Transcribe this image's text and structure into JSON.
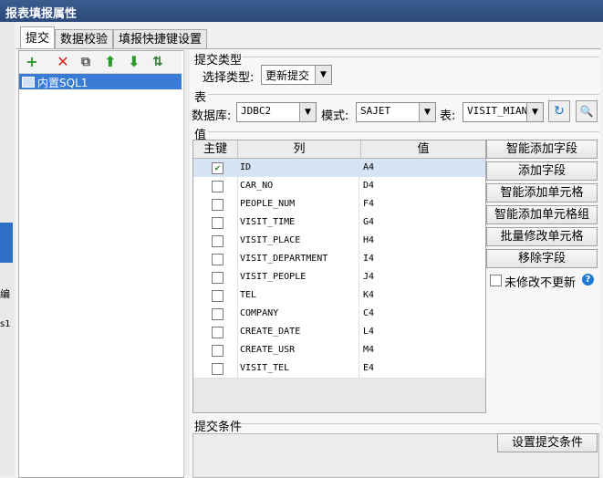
{
  "window": {
    "title": "报表填报属性"
  },
  "background": {
    "text1": "编",
    "text2": "s1"
  },
  "tabs": [
    {
      "label": "提交",
      "active": true
    },
    {
      "label": "数据校验",
      "active": false
    },
    {
      "label": "填报快捷键设置",
      "active": false
    }
  ],
  "toolbar": {
    "add": "+",
    "delete": "✕",
    "copy": "⧉",
    "up": "⬆",
    "down": "⬇",
    "sort": "⇅"
  },
  "list": {
    "items": [
      {
        "label": "内置SQL1",
        "selected": true
      }
    ]
  },
  "submit_type": {
    "group": "提交类型",
    "label": "选择类型:",
    "value": "更新提交"
  },
  "table_section": {
    "group": "表",
    "db_label": "数据库:",
    "db_value": "JDBC2",
    "schema_label": "模式:",
    "schema_value": "SAJET",
    "table_label": "表:",
    "table_value": "VISIT_MIAN"
  },
  "value_section": {
    "group": "值",
    "headers": [
      "主键",
      "列",
      "值"
    ],
    "rows": [
      {
        "key": true,
        "column": "ID",
        "value": "A4"
      },
      {
        "key": false,
        "column": "CAR_NO",
        "value": "D4"
      },
      {
        "key": false,
        "column": "PEOPLE_NUM",
        "value": "F4"
      },
      {
        "key": false,
        "column": "VISIT_TIME",
        "value": "G4"
      },
      {
        "key": false,
        "column": "VISIT_PLACE",
        "value": "H4"
      },
      {
        "key": false,
        "column": "VISIT_DEPARTMENT",
        "value": "I4"
      },
      {
        "key": false,
        "column": "VISIT_PEOPLE",
        "value": "J4"
      },
      {
        "key": false,
        "column": "TEL",
        "value": "K4"
      },
      {
        "key": false,
        "column": "COMPANY",
        "value": "C4"
      },
      {
        "key": false,
        "column": "CREATE_DATE",
        "value": "L4"
      },
      {
        "key": false,
        "column": "CREATE_USR",
        "value": "M4"
      },
      {
        "key": false,
        "column": "VISIT_TEL",
        "value": "E4"
      }
    ],
    "buttons": [
      "智能添加字段",
      "添加字段",
      "智能添加单元格",
      "智能添加单元格组",
      "批量修改单元格",
      "移除字段"
    ],
    "unchanged_label": "未修改不更新",
    "help": "?"
  },
  "condition_section": {
    "group": "提交条件",
    "button": "设置提交条件"
  },
  "colors": {
    "title_bar": "#2c4a7c",
    "selection": "#3a7bd5"
  }
}
